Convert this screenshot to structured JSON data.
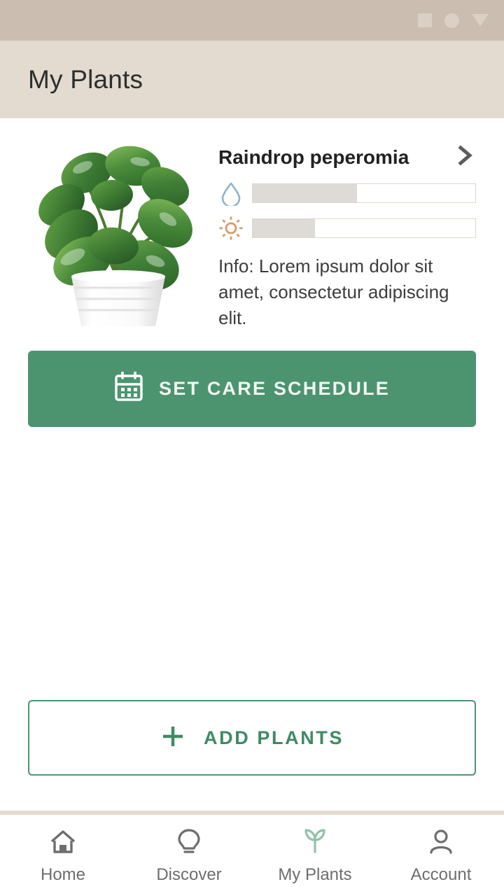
{
  "status_bar": {
    "icons": [
      "square-indicator",
      "circle-indicator",
      "triangle-indicator"
    ]
  },
  "app_bar": {
    "title": "My Plants"
  },
  "plant_card": {
    "photo_alt": "raindrop-peperomia-photo",
    "name": "Raindrop peperomia",
    "chevron": "chevron-right-icon",
    "meters": [
      {
        "icon": "water-drop-icon",
        "name": "water-level-meter",
        "percent": 47
      },
      {
        "icon": "sun-icon",
        "name": "light-level-meter",
        "percent": 28
      }
    ],
    "description": "Info: Lorem ipsum dolor sit amet, consectetur adipiscing elit."
  },
  "care_button": {
    "icon": "calendar-icon",
    "label": "SET CARE SCHEDULE"
  },
  "add_button": {
    "icon": "plus-icon",
    "label": "ADD PLANTS"
  },
  "bottom_nav": {
    "items": [
      {
        "label": "Home",
        "icon": "home-icon",
        "active": false
      },
      {
        "label": "Discover",
        "icon": "lightbulb-icon",
        "active": false
      },
      {
        "label": "My Plants",
        "icon": "sprout-icon",
        "active": true
      },
      {
        "label": "Account",
        "icon": "person-icon",
        "active": false
      }
    ]
  },
  "colors": {
    "status_bar": "#cbbdaf",
    "app_bar": "#e3dad0",
    "accent_green": "#4c9470",
    "water_icon": "#8fb4c8",
    "sun_icon": "#d89a68",
    "meter_fill": "#dedad5",
    "nav_active": "#8fc4a6",
    "nav_inactive": "#6e6e6e"
  }
}
